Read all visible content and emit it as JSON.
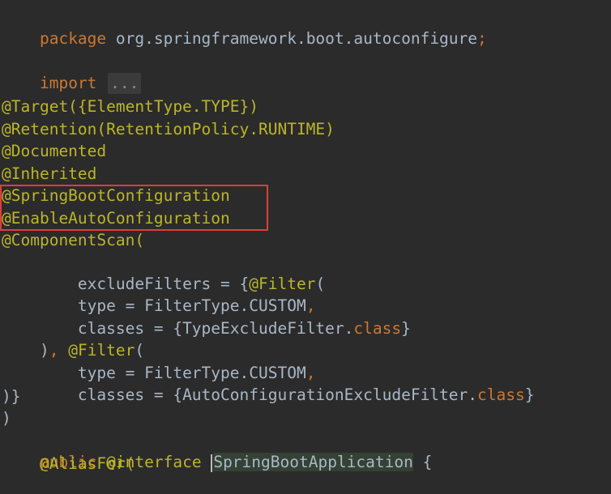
{
  "lines": {
    "l1": {
      "kw": "package",
      "text": " org.springframework.boot.autoconfigure",
      "semi": ";"
    },
    "l2": {
      "kw": "import",
      "fold": "..."
    },
    "l3": {
      "text": "@Target({ElementType.TYPE})"
    },
    "l4": {
      "text": "@Retention(RetentionPolicy.RUNTIME)"
    },
    "l5": {
      "text": "@Documented"
    },
    "l6": {
      "text": "@Inherited"
    },
    "l7": {
      "text": "@SpringBootConfiguration"
    },
    "l8": {
      "text": "@EnableAutoConfiguration"
    },
    "l9": {
      "text": "@ComponentScan("
    },
    "l10": {
      "pre": "    excludeFilters = {",
      "ann": "@Filter",
      "post": "("
    },
    "l11": {
      "pre": "    type = FilterType.CUSTOM",
      "comma": ","
    },
    "l12": {
      "pre": "    classes = {TypeExcludeFilter.",
      "kw": "class",
      "post": "}"
    },
    "l13": {
      "pre": ")",
      "comma": ",",
      "mid": " ",
      "ann": "@Filter",
      "post": "("
    },
    "l14": {
      "pre": "    type = FilterType.CUSTOM",
      "comma": ","
    },
    "l15": {
      "pre": "    classes = {AutoConfigurationExcludeFilter.",
      "kw": "class",
      "post": "}"
    },
    "l16": {
      "text": ")}"
    },
    "l17": {
      "text": ")"
    },
    "l18": {
      "kw1": "public",
      "kw2": "@interface",
      "name": "SpringBootApplication",
      "post": " {"
    },
    "l19": {
      "text": "    @AliasFor("
    }
  },
  "highlight": {
    "box_color": "#e03c3c"
  },
  "colors": {
    "background": "#2b2b2b",
    "keyword": "#cc7832",
    "annotation": "#bbb529",
    "text": "#a9b7c6"
  }
}
